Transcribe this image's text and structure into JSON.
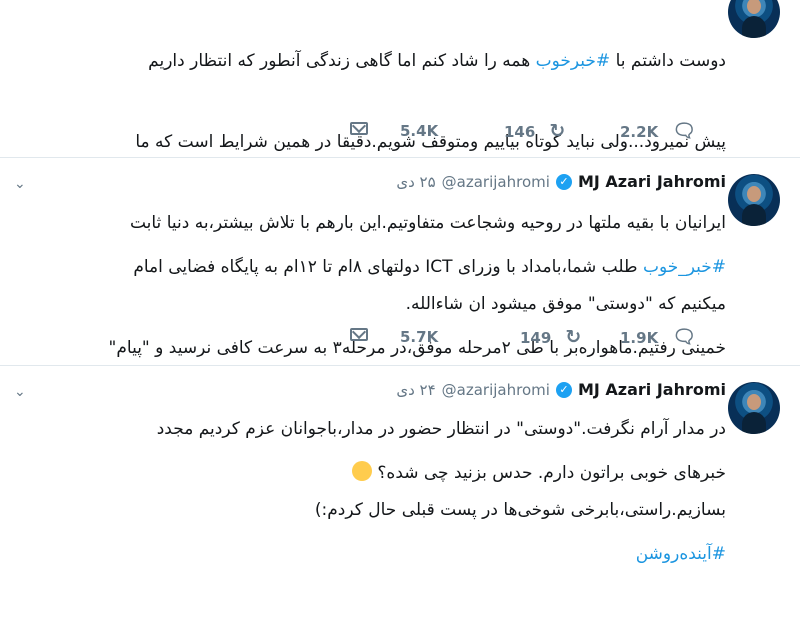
{
  "tweets": [
    {
      "text_lines": [
        "دوست داشتم با #خبرخوب همه را شاد کنم اما گاهی زندگی آنطور که انتظار داریم",
        "پیش نمیرود...ولی نباید کوتاه بیاییم ومتوقف شویم.دقیقا در همین شرایط است که ما",
        "ایرانیان با بقیه ملتها در روحیه وشجاعت متفاوتیم.این بارهم با تلاش بیشتر،به دنیا ثابت",
        "میکنیم که \"دوستی\" موفق میشود ان شاءالله."
      ],
      "hashtag": "#خبرخوب",
      "likes": "5.4K",
      "retweets": "146",
      "replies": "2.2K"
    },
    {
      "name": "MJ Azari Jahromi",
      "handle": "@azarijahromi",
      "date": "۲۵ دی",
      "text_lines": [
        "#خبر_خوب طلب شما،بامداد با وزرای ICT دولتهای ۸ام تا ۱۲ام به پایگاه فضایی امام",
        "خمینی رفتیم.ماهواره‌بر با طی ۲مرحله موفق،در مرحله۳ به سرعت کافی نرسید و \"پیام\"",
        "در مدار آرام نگرفت.\"دوستی\" در انتظار حضور در مدار،باجوانان عزم کردیم مجدد",
        "بسازیم.راستی،بابرخی شوخی‌ها در پست قبلی حال کردم:)"
      ],
      "hashtag": "#خبر_خوب",
      "likes": "5.7K",
      "retweets": "149",
      "replies": "1.9K"
    },
    {
      "name": "MJ Azari Jahromi",
      "handle": "@azarijahromi",
      "date": "۲۴ دی",
      "text_lines": [
        "خبرهای خوبی براتون دارم. حدس بزنید چی شده؟",
        "#آینده‌روشن"
      ],
      "emoji": "winking-face-emoji"
    }
  ],
  "colors": {
    "accent": "#1b95e0",
    "verified": "#1da1f2",
    "muted": "#657786",
    "divider": "#e1e8ed"
  }
}
